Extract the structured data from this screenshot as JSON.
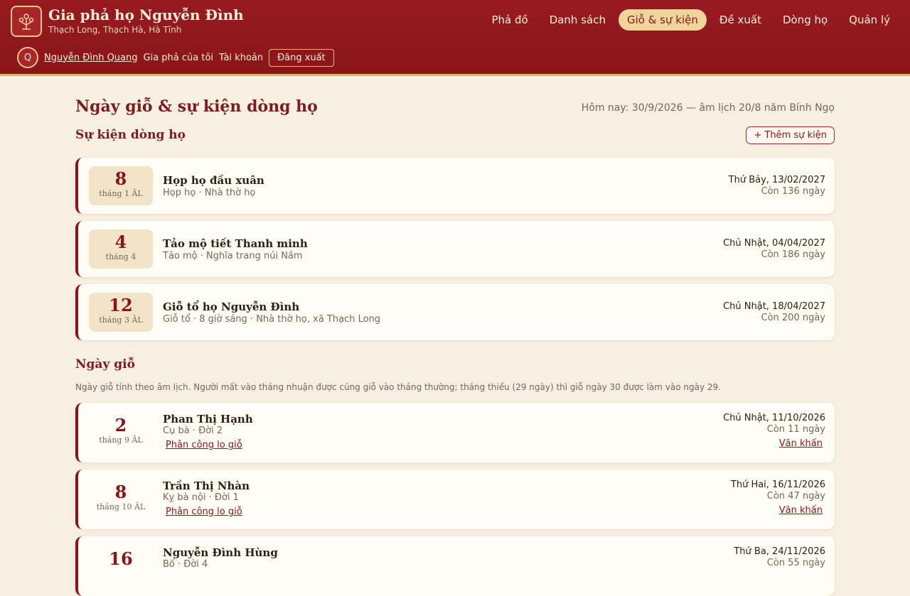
{
  "header": {
    "title": "Gia phả họ Nguyễn Đình",
    "subtitle": "Thạch Long, Thạch Hà, Hà Tĩnh",
    "nav": [
      "Phả đồ",
      "Danh sách",
      "Giỗ & sự kiện",
      "Đề xuất",
      "Dòng họ",
      "Quản lý"
    ],
    "active_nav": "Giỗ & sự kiện",
    "user": {
      "avatar_initial": "Q",
      "name": "Nguyễn Đình Quang",
      "my_tree": "Gia phả của tôi",
      "account": "Tài khoản",
      "logout": "Đăng xuất"
    },
    "colors": {
      "primary": "#8a1519",
      "accent": "#f1d49c",
      "gold_border": "#d9b76a"
    }
  },
  "page": {
    "title": "Ngày giỗ & sự kiện dòng họ",
    "today": "Hôm nay: 30/9/2026 — âm lịch 20/8 năm Bính Ngọ"
  },
  "events_section": {
    "title": "Sự kiện dòng họ",
    "add_button": "+ Thêm sự kiện",
    "items": [
      {
        "day": "8",
        "month": "tháng 1 ÂL",
        "name": "Họp họ đầu xuân",
        "sub": "Họp họ · Nhà thờ họ",
        "date": "Thứ Bảy, 13/02/2027",
        "remaining": "Còn 136 ngày"
      },
      {
        "day": "4",
        "month": "tháng 4",
        "name": "Tảo mộ tiết Thanh minh",
        "sub": "Tảo mộ · Nghĩa trang núi Nầm",
        "date": "Chủ Nhật, 04/04/2027",
        "remaining": "Còn 186 ngày"
      },
      {
        "day": "12",
        "month": "tháng 3 ÂL",
        "name": "Giỗ tổ họ Nguyễn Đình",
        "sub": "Giỗ tổ · 8 giờ sáng · Nhà thờ họ, xã Thạch Long",
        "date": "Chủ Nhật, 18/04/2027",
        "remaining": "Còn 200 ngày"
      }
    ]
  },
  "anniversary_section": {
    "title": "Ngày giỗ",
    "note": "Ngày giỗ tính theo âm lịch. Người mất vào tháng nhuận được cúng giỗ vào tháng thường; tháng thiếu (29 ngày) thì giỗ ngày 30 được làm vào ngày 29.",
    "items": [
      {
        "day": "2",
        "month": "tháng 9 ÂL",
        "name": "Phan Thị Hạnh",
        "sub": "Cụ bà · Đời 2",
        "assign": "Phân công lo giỗ",
        "date": "Chủ Nhật, 11/10/2026",
        "remaining": "Còn 11 ngày",
        "prayer": "Văn khấn"
      },
      {
        "day": "8",
        "month": "tháng 10 ÂL",
        "name": "Trần Thị Nhàn",
        "sub": "Kỵ bà nội · Đời 1",
        "assign": "Phân công lo giỗ",
        "date": "Thứ Hai, 16/11/2026",
        "remaining": "Còn 47 ngày",
        "prayer": "Văn khấn"
      },
      {
        "day": "16",
        "month": "",
        "name": "Nguyễn Đình Hùng",
        "sub": "Bố · Đời 4",
        "assign": "",
        "date": "Thứ Ba, 24/11/2026",
        "remaining": "Còn 55 ngày",
        "prayer": ""
      }
    ]
  }
}
